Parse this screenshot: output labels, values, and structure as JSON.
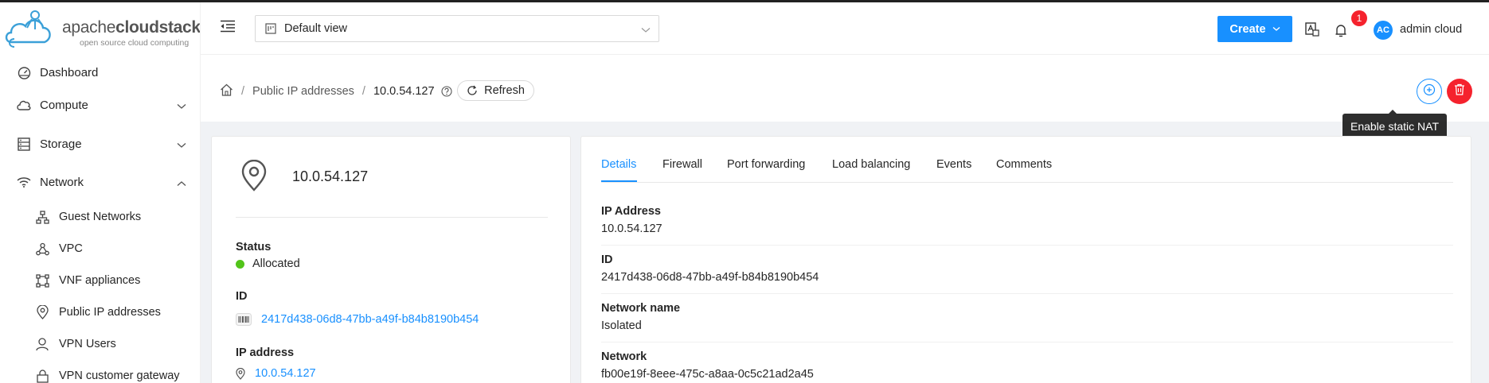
{
  "brand": {
    "name_light": "apache",
    "name_bold": "cloudstack",
    "tagline": "open source cloud computing"
  },
  "sidebar": {
    "items": [
      {
        "label": "Dashboard",
        "icon": "dashboard-icon"
      },
      {
        "label": "Compute",
        "icon": "cloud-icon"
      },
      {
        "label": "Storage",
        "icon": "database-icon"
      },
      {
        "label": "Network",
        "icon": "wifi-icon"
      }
    ],
    "network_children": [
      {
        "label": "Guest Networks",
        "icon": "apartment-icon"
      },
      {
        "label": "VPC",
        "icon": "deployment-unit-icon"
      },
      {
        "label": "VNF appliances",
        "icon": "gateway-icon"
      },
      {
        "label": "Public IP addresses",
        "icon": "environment-icon"
      },
      {
        "label": "VPN Users",
        "icon": "user-icon"
      },
      {
        "label": "VPN customer gateway",
        "icon": "lock-icon"
      }
    ]
  },
  "header": {
    "view_select": "Default view",
    "create_label": "Create",
    "notification_count": "1",
    "user_initials": "AC",
    "user_name": "admin cloud"
  },
  "breadcrumb": {
    "parent": "Public IP addresses",
    "current": "10.0.54.127",
    "refresh_label": "Refresh"
  },
  "actions": {
    "tooltip": "Enable static NAT"
  },
  "resource": {
    "name": "10.0.54.127",
    "status_label": "Status",
    "status_value": "Allocated",
    "id_label": "ID",
    "id_value": "2417d438-06d8-47bb-a49f-b84b8190b454",
    "ip_label": "IP address",
    "ip_value": "10.0.54.127"
  },
  "tabs": [
    "Details",
    "Firewall",
    "Port forwarding",
    "Load balancing",
    "Events",
    "Comments"
  ],
  "details": [
    {
      "label": "IP Address",
      "value": "10.0.54.127"
    },
    {
      "label": "ID",
      "value": "2417d438-06d8-47bb-a49f-b84b8190b454"
    },
    {
      "label": "Network name",
      "value": "Isolated"
    },
    {
      "label": "Network",
      "value": "fb00e19f-8eee-475c-a8aa-0c5c21ad2a45"
    }
  ],
  "colors": {
    "primary": "#1890ff",
    "danger": "#f5222d",
    "success": "#52c41a"
  }
}
